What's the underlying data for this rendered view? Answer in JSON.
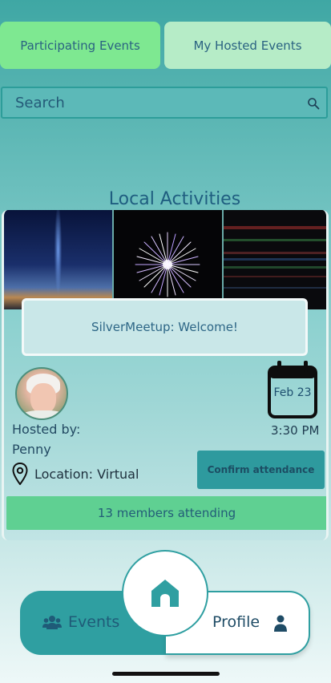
{
  "tabs": {
    "participating": "Participating Events",
    "hosted": "My Hosted Events"
  },
  "search": {
    "placeholder": "Search",
    "icon": "search-icon"
  },
  "section": {
    "title": "Local Activities"
  },
  "event": {
    "title": "SilverMeetup: Welcome!",
    "hosted_by_label": "Hosted by:",
    "host_name": "Penny",
    "location": "Location: Virtual",
    "date": "Feb 23",
    "time": "3:30 PM",
    "confirm_label": "Confirm attendance",
    "attending": "13 members attending"
  },
  "nav": {
    "events_label": "Events",
    "profile_label": "Profile"
  },
  "colors": {
    "accent": "#2f9fa1",
    "active_tab": "#7ee891",
    "inactive_tab": "#b6ecc7",
    "attending_bar": "#5fd092",
    "text": "#235a7a"
  }
}
